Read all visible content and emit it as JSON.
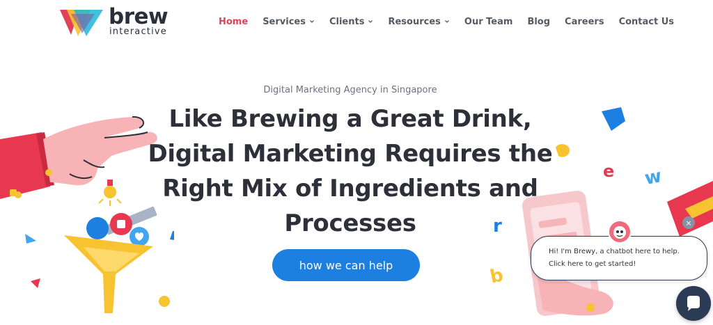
{
  "brand": {
    "name": "brew",
    "sub": "interactive",
    "colors": {
      "red": "#e04358",
      "yellow": "#f7c331",
      "blue": "#1d7fe0",
      "dark": "#2b2f3a",
      "navy": "#2b3a55",
      "pink": "#f6b5b9"
    }
  },
  "nav": {
    "items": [
      {
        "label": "Home",
        "active": true,
        "dropdown": false
      },
      {
        "label": "Services",
        "active": false,
        "dropdown": true
      },
      {
        "label": "Clients",
        "active": false,
        "dropdown": true
      },
      {
        "label": "Resources",
        "active": false,
        "dropdown": true
      },
      {
        "label": "Our Team",
        "active": false,
        "dropdown": false
      },
      {
        "label": "Blog",
        "active": false,
        "dropdown": false
      },
      {
        "label": "Careers",
        "active": false,
        "dropdown": false
      },
      {
        "label": "Contact Us",
        "active": false,
        "dropdown": false
      }
    ]
  },
  "hero": {
    "eyebrow": "Digital Marketing Agency in Singapore",
    "headline_lines": [
      "Like Brewing a Great Drink,",
      "Digital Marketing Requires the",
      "Right Mix of Ingredients and",
      "Processes"
    ],
    "cta_label": "how we can help"
  },
  "decor": {
    "letters": [
      "e",
      "w",
      "r",
      "b"
    ],
    "icons": [
      "hand-icon",
      "funnel-icon",
      "lightbulb-icon",
      "like-icon",
      "heart-icon",
      "ruler-icon",
      "phone-icon"
    ]
  },
  "chatbot": {
    "message_line1": "Hi! I'm Brewy, a chatbot here to help.",
    "message_line2": "Click here to get started!",
    "close_glyph": "×"
  }
}
